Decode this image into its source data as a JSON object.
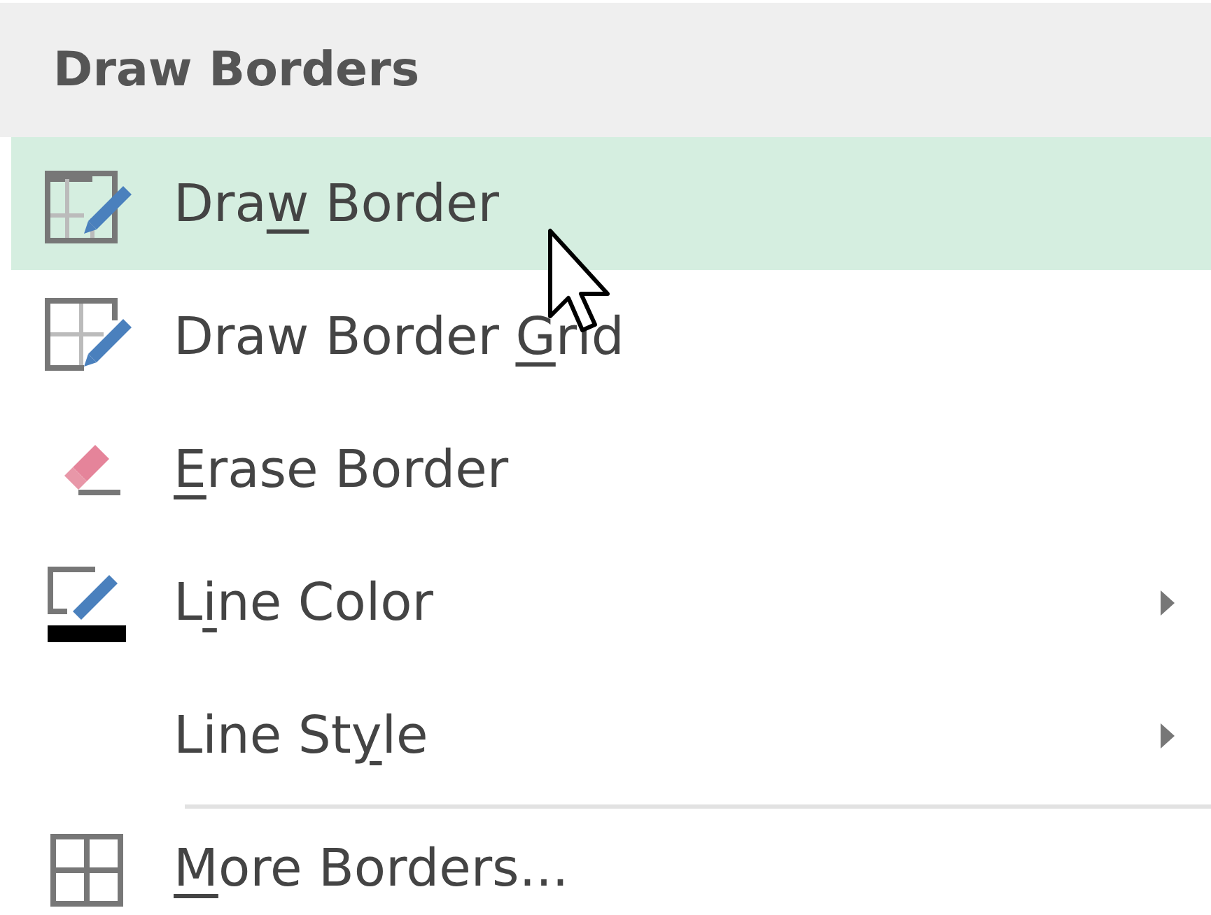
{
  "menu": {
    "title": "Draw Borders",
    "items": [
      {
        "before": "Dra",
        "key": "w",
        "after": " Border",
        "selected": true,
        "submenu": false,
        "separator_before": false
      },
      {
        "before": "Draw Border ",
        "key": "G",
        "after": "rid",
        "selected": false,
        "submenu": false,
        "separator_before": false
      },
      {
        "key": "E",
        "after": "rase Border",
        "selected": false,
        "submenu": false,
        "separator_before": false
      },
      {
        "before": "L",
        "key": "i",
        "after": "ne Color",
        "selected": false,
        "submenu": true,
        "separator_before": false
      },
      {
        "before": "Line St",
        "key": "y",
        "after": "le",
        "selected": false,
        "submenu": true,
        "separator_before": false
      },
      {
        "key": "M",
        "after": "ore Borders...",
        "selected": false,
        "submenu": false,
        "separator_before": true
      }
    ]
  }
}
